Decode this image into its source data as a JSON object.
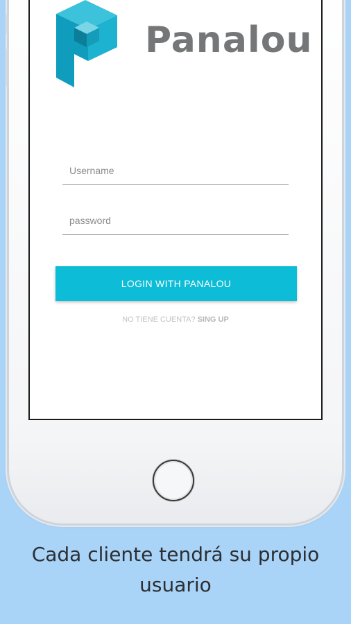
{
  "app": {
    "brand_name": "Panalou",
    "brand_color": "#13a8c9",
    "brand_text_color": "#747678"
  },
  "login_form": {
    "username_placeholder": "Username",
    "username_value": "",
    "password_placeholder": "password",
    "password_value": "",
    "login_button_label": "LOGIN WITH PANALOU",
    "login_button_color": "#0dbcd6",
    "no_account_text": "NO TIENE CUENTA?",
    "signup_link_label": "SING UP"
  },
  "caption": {
    "line1": "Cada cliente tendrá su propio",
    "line2": "usuario"
  },
  "icons": {
    "logo": "panalou-cube-logo-icon",
    "home": "home-button"
  }
}
